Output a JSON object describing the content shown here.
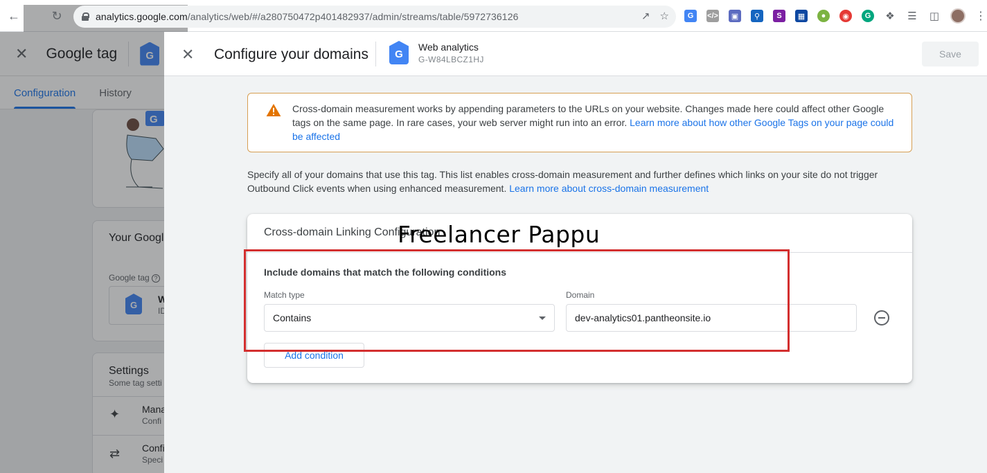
{
  "browser": {
    "url_host": "analytics.google.com",
    "url_path": "/analytics/web/#/a280750472p401482937/admin/streams/table/5972736126"
  },
  "left_panel": {
    "title": "Google tag",
    "tabs": [
      {
        "label": "Configuration",
        "active": true
      },
      {
        "label": "History",
        "active": false
      }
    ],
    "card_title_partial": "Your Googl",
    "google_tag_label": "Google tag",
    "tag_row_title_partial": "W",
    "tag_row_sub_partial": "ID",
    "settings_title": "Settings",
    "settings_sub_partial": "Some tag setti",
    "items": [
      {
        "title_partial": "Mana",
        "sub_partial": "Confi",
        "icon": "sparkle-icon"
      },
      {
        "title_partial": "Confi",
        "sub_partial": "Speci",
        "icon": "merge-arrows-icon"
      }
    ]
  },
  "sheet": {
    "title": "Configure your domains",
    "stream_name": "Web analytics",
    "stream_id": "G-W84LBCZ1HJ",
    "save_label": "Save",
    "warning": {
      "text": "Cross-domain measurement works by appending parameters to the URLs on your website. Changes made here could affect other Google tags on the same page. In rare cases, your web server might run into an error. ",
      "link": "Learn more about how other Google Tags on your page could be affected"
    },
    "intro": {
      "text": "Specify all of your domains that use this tag. This list enables cross-domain measurement and further defines which links on your site do not trigger Outbound Click events when using enhanced measurement. ",
      "link": "Learn more about cross-domain measurement"
    },
    "card": {
      "title": "Cross-domain Linking Configuration",
      "condition_heading": "Include domains that match the following conditions",
      "match_type_label": "Match type",
      "match_type_value": "Contains",
      "domain_label": "Domain",
      "domain_value": "dev-analytics01.pantheonsite.io",
      "add_condition_label": "Add condition"
    }
  },
  "overlay": {
    "watermark": "Freelancer Pappu",
    "highlight_color": "#d32f2f"
  },
  "colors": {
    "accent": "#1a73e8",
    "tag_blue": "#4285f4",
    "warning_border": "#d69e52",
    "warning_icon": "#e37400"
  }
}
